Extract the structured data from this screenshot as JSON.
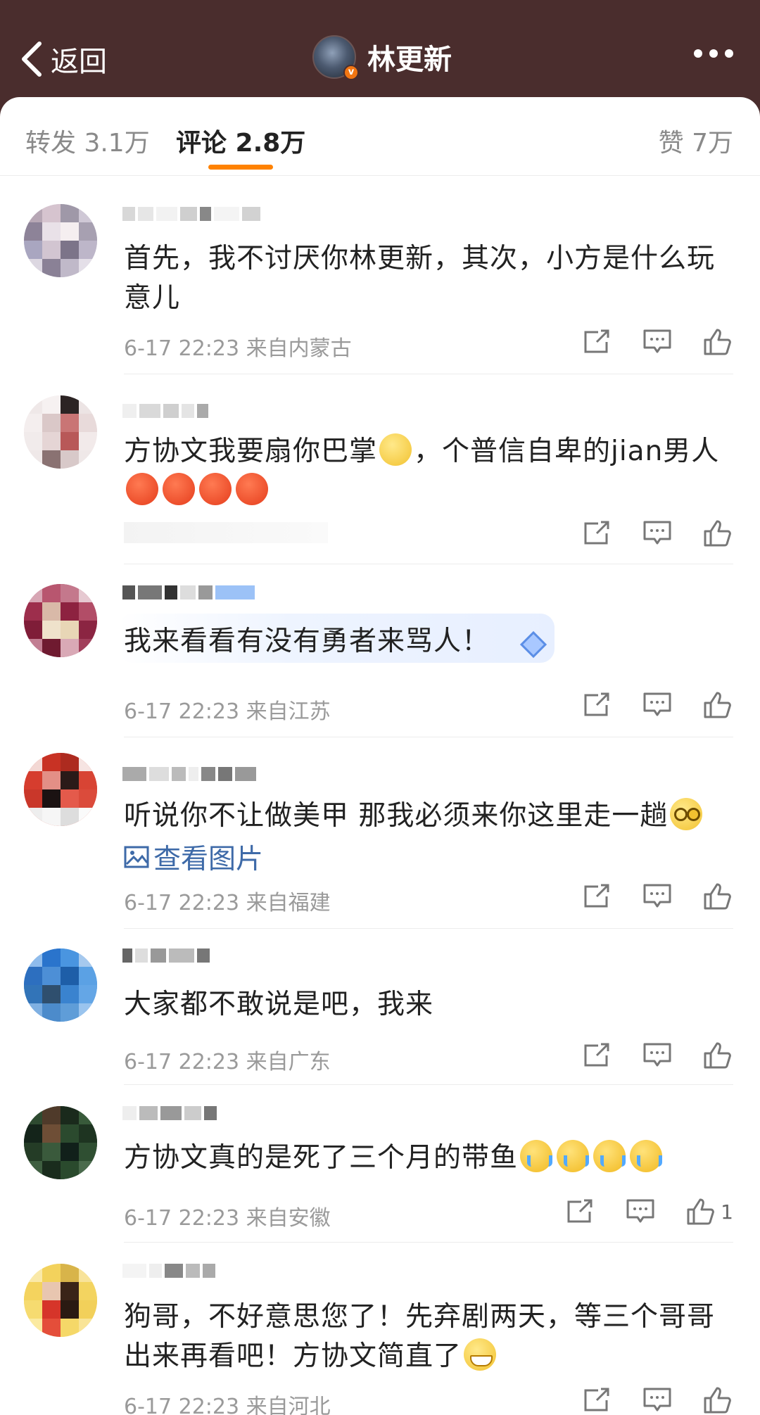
{
  "header": {
    "back_label": "返回",
    "title": "林更新",
    "verified_badge": "v"
  },
  "tabs": {
    "repost": "转发 3.1万",
    "comments": "评论 2.8万",
    "likes": "赞 7万"
  },
  "comments": [
    {
      "text": "首先，我不讨厌你林更新，其次，小方是什么玩意儿",
      "meta": "6-17 22:23 来自内蒙古"
    },
    {
      "text": "方协文我要扇你巴掌",
      "text2": "，个普信自卑的jian男人",
      "meta": ""
    },
    {
      "text": "我来看看有没有勇者来骂人！",
      "meta": "6-17 22:23 来自江苏"
    },
    {
      "text": "听说你不让做美甲 那我必须来你这里走一趟",
      "photo_link": "查看图片",
      "meta": "6-17 22:23 来自福建"
    },
    {
      "text": "大家都不敢说是吧，我来",
      "meta": "6-17 22:23 来自广东"
    },
    {
      "text": "方协文真的是死了三个月的带鱼",
      "meta": "6-17 22:23 来自安徽",
      "like_count": "1"
    },
    {
      "text": "狗哥，不好意思您了！先弃剧两天，等三个哥哥出来再看吧！方协文简直了",
      "meta": "6-17 22:23 来自河北"
    }
  ],
  "icons": {
    "back": "chevron-left-icon",
    "more": "more-dots-icon",
    "repost": "share-out-icon",
    "reply": "comment-bubble-icon",
    "like": "thumbs-up-icon",
    "photo": "image-icon"
  },
  "colors": {
    "header_bg": "#4a2d2d",
    "tab_indicator": "#ff8200",
    "link": "#3e6aa8"
  }
}
